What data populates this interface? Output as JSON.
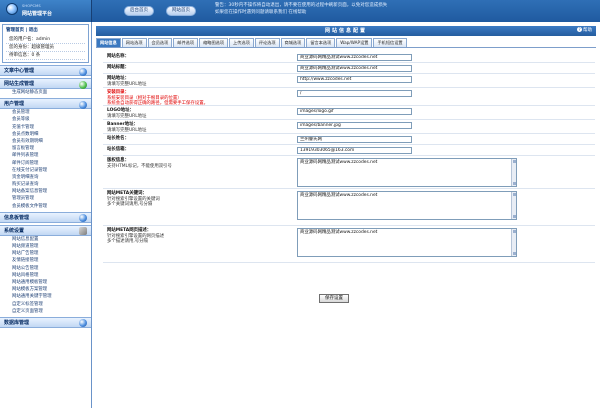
{
  "logo": {
    "small": "SHOPCMS",
    "title": "网站管理平台"
  },
  "top_buttons": [
    "后台首页",
    "网站首页"
  ],
  "notice": "警告：30秒内不操作将自动退出，请不要在使用的过程中刷新页面，以免对您造成损失\n如果您在操作时遇到问题请联系我们 在线帮助",
  "sidebar": {
    "user_links": "管理首页 | 退出",
    "user_rows": [
      "您的用户名：admin",
      "您的身份：超级管理员",
      "待审信息：0 条"
    ],
    "sections": [
      {
        "title": "文章中心管理",
        "icon": "blue",
        "items": []
      },
      {
        "title": "网站生成管理",
        "icon": "green",
        "items": [
          "生成网站静态页面"
        ]
      },
      {
        "title": "用户管理",
        "icon": "blue",
        "items": [
          "会员管理",
          "会员等级",
          "充值卡管理",
          "会员点数明细",
          "会员有效期明细",
          "留言板管理",
          "邮件列表管理",
          "邮件订阅管理",
          "在线支付记录管理",
          "资金明细查询",
          "购买记录查询",
          "网站备案信息管理",
          "管理员管理",
          "会员模板文件管理"
        ]
      },
      {
        "title": "信息板管理",
        "icon": "blue",
        "items": []
      },
      {
        "title": "系统设置",
        "icon": "tool",
        "items": [
          "网站信息配置",
          "网站频道管理",
          "网站广告管理",
          "友情链接管理",
          "网站公告管理",
          "网站风格管理",
          "网站通用模板管理",
          "网站模板方案管理",
          "网站通用关键字管理",
          "自定义标签管理",
          "自定义页面管理"
        ]
      },
      {
        "title": "数据库管理",
        "icon": "blue",
        "items": []
      }
    ]
  },
  "main": {
    "title": "网站信息配置",
    "help": "帮助",
    "tabs": [
      "网站信息",
      "网站选项",
      "会员选项",
      "邮件选项",
      "缩略图选项",
      "上传选项",
      "评论选项",
      "商城选项",
      "留言本选项",
      "Wap/WAP设置",
      "手机短信设置"
    ],
    "active_tab": 0,
    "fields": [
      {
        "label": "网站名称：",
        "desc": "",
        "value": "商业源码网精品测试www.zzcodes.net",
        "type": "input"
      },
      {
        "label": "网站标题：",
        "desc": "",
        "value": "商业源码网精品测试www.zzcodes.net",
        "type": "input"
      },
      {
        "label": "网站地址：",
        "desc": "请填写完整URL地址",
        "value": "http://www.zzcodes.net",
        "type": "input"
      },
      {
        "label": "安装目录：",
        "desc": "系统安装目录（相对于根目录的位置）",
        "desc2": "系统会自动获得正确的路径，但需要手工保存设置。",
        "value": "/",
        "type": "input",
        "red": true
      },
      {
        "label": "LOGO地址：",
        "desc": "请填写完整URL地址",
        "value": "images/logo.gif",
        "type": "input"
      },
      {
        "label": "Banner地址：",
        "desc": "请填写完整URL地址",
        "value": "images/banner.jpg",
        "type": "input"
      },
      {
        "label": "站长姓名：",
        "desc": "",
        "value": "兰州睿氏网",
        "type": "input"
      },
      {
        "label": "站长信箱：",
        "desc": "",
        "value": "13919303065@163.com",
        "type": "input"
      },
      {
        "label": "版权信息：",
        "desc": "支持HTML标记，不能使用双引号",
        "value": "商业源码网精品测试www.zzcodes.net",
        "type": "textarea"
      },
      {
        "label": "网站META关键词：",
        "desc": "针对搜索引擎设置的关键词",
        "desc2": "多个关键词请用,号分隔",
        "value": "商业源码网精品测试www.zzcodes.net",
        "type": "textarea"
      },
      {
        "label": "网站META网页描述：",
        "desc": "针对搜索引擎设置的网页描述",
        "desc2": "多个描述请用,号分隔",
        "value": "商业源码网精品测试www.zzcodes.net",
        "type": "textarea"
      }
    ],
    "save_label": "保存设置"
  }
}
